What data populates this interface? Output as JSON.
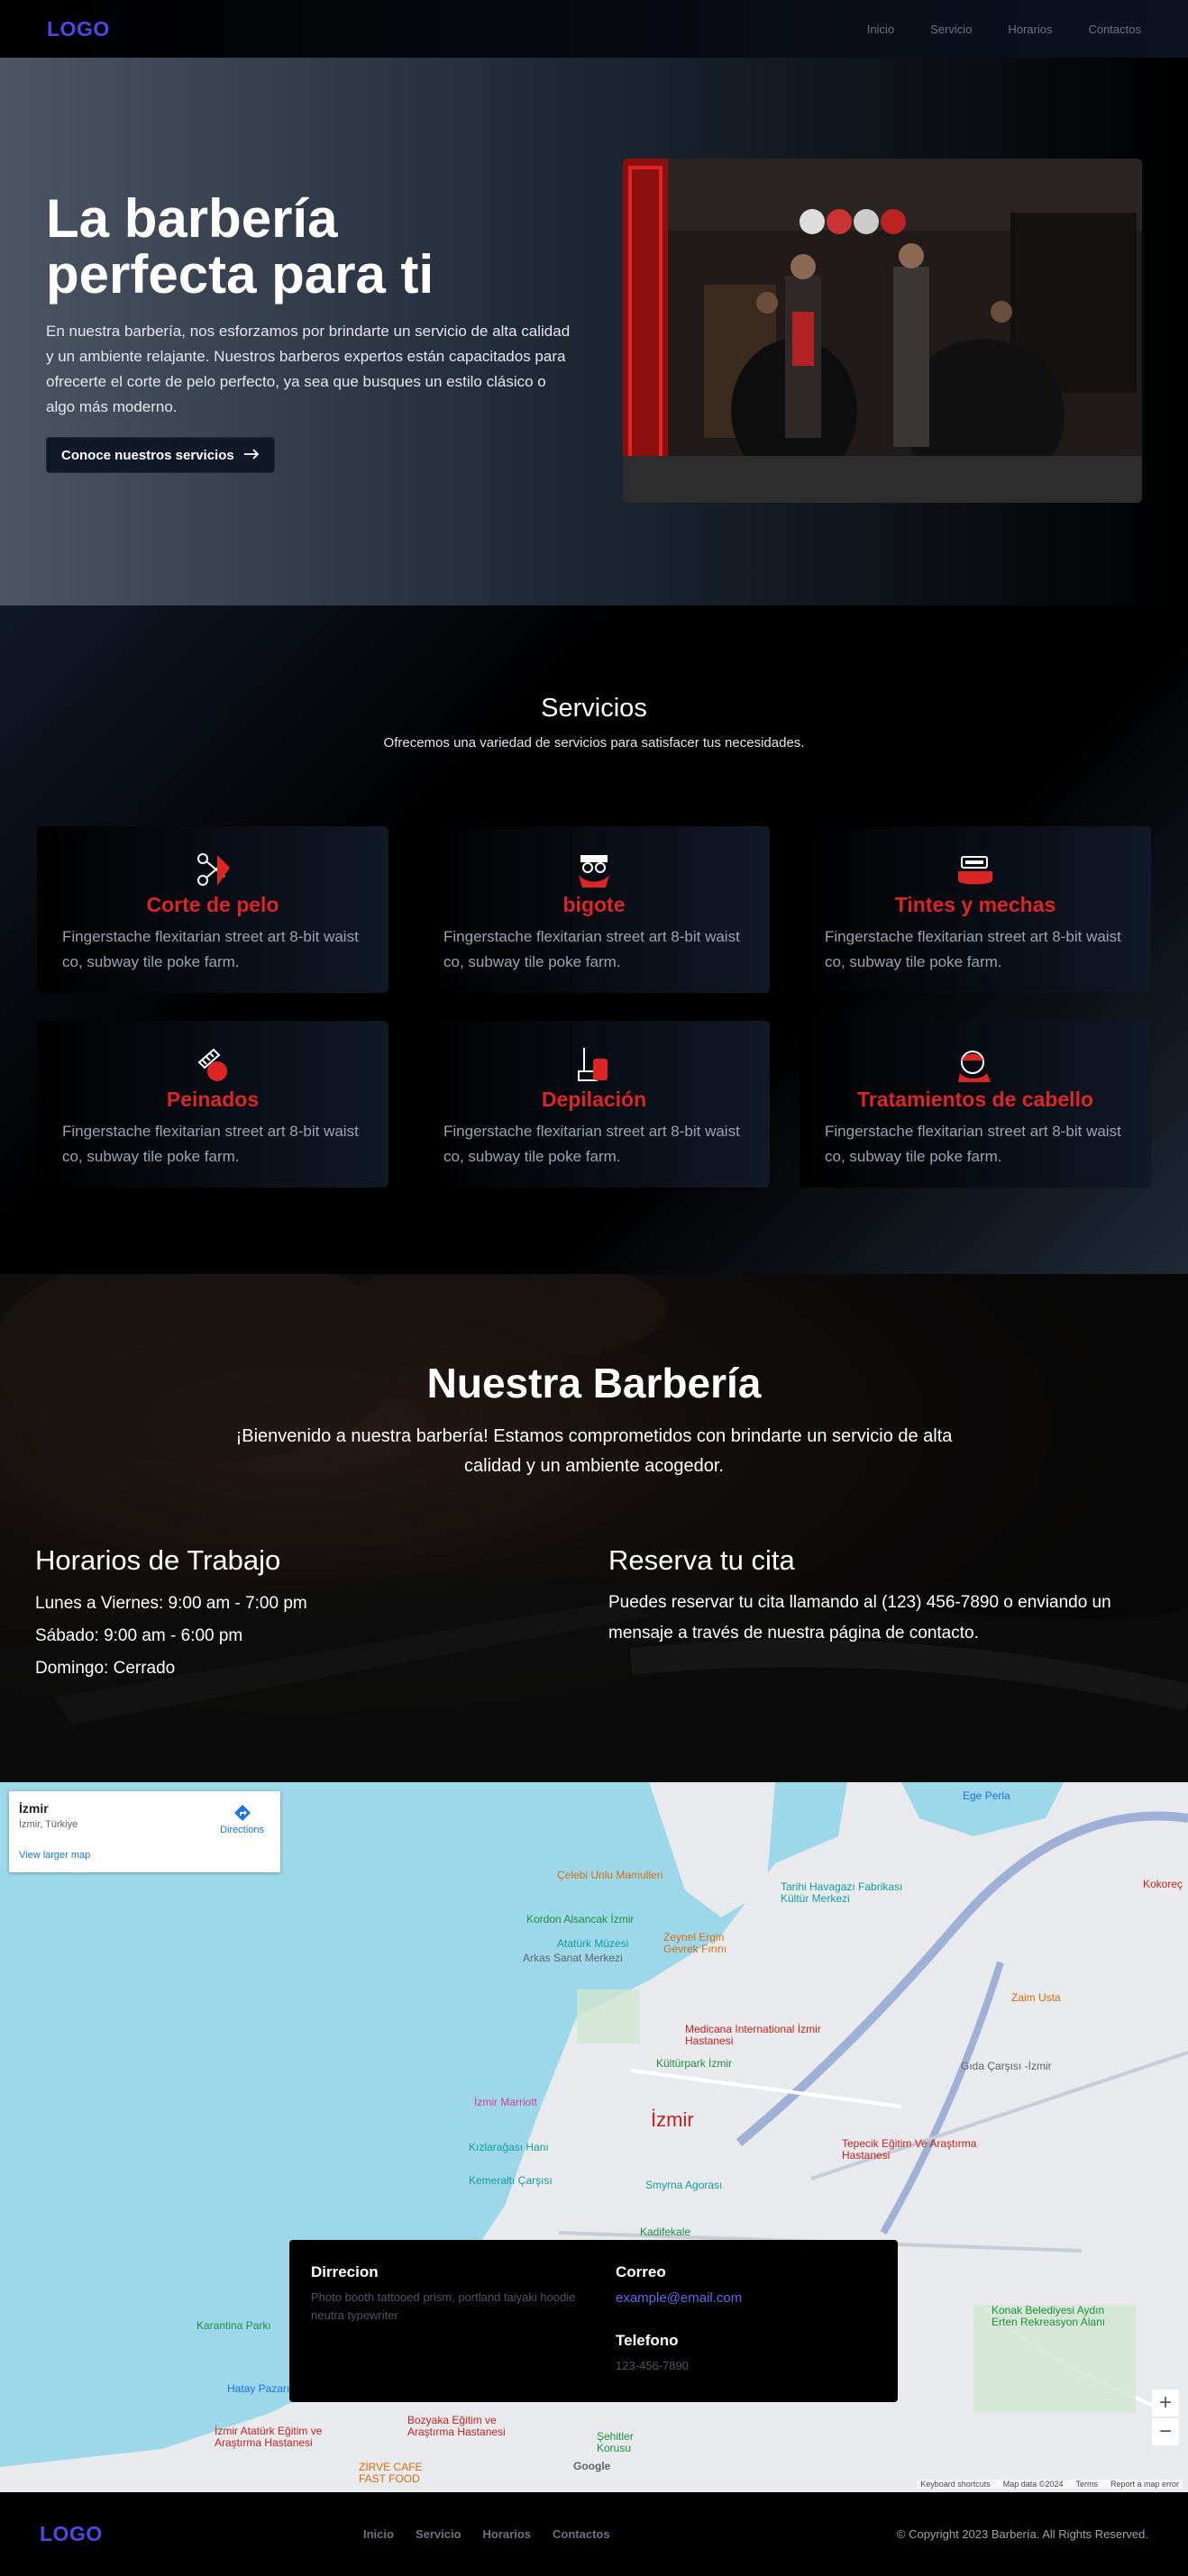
{
  "nav": {
    "logo": "LOGO",
    "links": [
      "Inicio",
      "Servicio",
      "Horarios",
      "Contactos"
    ]
  },
  "hero": {
    "title": "La barbería perfecta para ti",
    "text": "En nuestra barbería, nos esforzamos por brindarte un servicio de alta calidad y un ambiente relajante. Nuestros barberos expertos están capacitados para ofrecerte el corte de pelo perfecto, ya sea que busques un estilo clásico o algo más moderno.",
    "button": "Conoce nuestros servicios",
    "button_icon": "arrow-right-icon"
  },
  "services": {
    "title": "Servicios",
    "subtitle": "Ofrecemos una variedad de servicios para satisfacer tus necesidades.",
    "accent": "#dc2626",
    "items": [
      {
        "title": "Corte de pelo",
        "text": "Fingerstache flexitarian street art 8-bit waist co, subway tile poke farm.",
        "icon": "scissors-comb-icon"
      },
      {
        "title": "bigote",
        "text": "Fingerstache flexitarian street art 8-bit waist co, subway tile poke farm.",
        "icon": "mustache-face-icon"
      },
      {
        "title": "Tintes y mechas",
        "text": "Fingerstache flexitarian street art 8-bit waist co, subway tile poke farm.",
        "icon": "hair-dye-icon"
      },
      {
        "title": "Peinados",
        "text": "Fingerstache flexitarian street art 8-bit waist co, subway tile poke farm.",
        "icon": "comb-icon"
      },
      {
        "title": "Depilación",
        "text": "Fingerstache flexitarian street art 8-bit waist co, subway tile poke farm.",
        "icon": "wax-strip-icon"
      },
      {
        "title": "Tratamientos de cabello",
        "text": "Fingerstache flexitarian street art 8-bit waist co, subway tile poke farm.",
        "icon": "hair-treatment-icon"
      }
    ]
  },
  "barberia": {
    "title": "Nuestra Barbería",
    "intro": "¡Bienvenido a nuestra barbería! Estamos comprometidos con brindarte un servicio de alta calidad y un ambiente acogedor.",
    "hours_title": "Horarios de Trabajo",
    "hours": [
      "Lunes a Viernes: 9:00 am - 7:00 pm",
      "Sábado: 9:00 am - 6:00 pm",
      "Domingo: Cerrado"
    ],
    "booking_title": "Reserva tu cita",
    "booking_text": "Puedes reservar tu cita llamando al (123) 456-7890 o enviando un mensaje a través de nuestra página de contacto."
  },
  "map": {
    "place": "İzmir",
    "region": "İzmir, Türkiye",
    "directions": "Directions",
    "larger": "View larger map",
    "city_label": "İzmir",
    "labels": [
      "Çelebi Unlu Mamulleri",
      "Kordon Alsancak İzmir",
      "Atatürk Müzesi",
      "Arkas Sanat Merkezi",
      "Zeynel Ergin Gevrek Fırını",
      "Tarihi Havagazı Fabrikası Kültür Merkezi",
      "Medicana International İzmir Hastanesi",
      "Kültürpark İzmir",
      "İzmir Marriott",
      "Kızlarağası Hanı",
      "Kemeraltı Çarşısı",
      "Smyrna Agorası",
      "Tepecik Eğitim Ve Araştırma Hastanesi",
      "Gıda Çarşısı -İzmir",
      "Zaim Usta",
      "Kadifekale",
      "Konak Belediyesi Aydın Erten Rekreasyon Alanı",
      "Karantina Parkı",
      "Hatay Pazarı",
      "Bozyaka Eğitim ve Araştırma Hastanesi",
      "İzmir Atatürk Eğitim ve Araştırma Hastanesi",
      "ZİRVE CAFE FAST FOOD",
      "Şehitler Korusu",
      "Ege Perla",
      "Kokoreç"
    ],
    "attribution": [
      "Keyboard shortcuts",
      "Map data ©2024",
      "Terms",
      "Report a map error"
    ],
    "brand": "Google"
  },
  "contact": {
    "address_title": "Dirrecion",
    "address_text": "Photo booth tattooed prism, portland taiyaki hoodie neutra typewriter",
    "email_title": "Correo",
    "email": "example@email.com",
    "phone_title": "Telefono",
    "phone": "123-456-7890"
  },
  "footer": {
    "logo": "LOGO",
    "links": [
      "Inicio",
      "Servicio",
      "Horarios",
      "Contactos"
    ],
    "copyright": "© Copyright 2023 Barbería. All Rights Reserved."
  },
  "colors": {
    "brand": "#4f46e5",
    "accent": "#dc2626",
    "link": "#1a73e8"
  }
}
